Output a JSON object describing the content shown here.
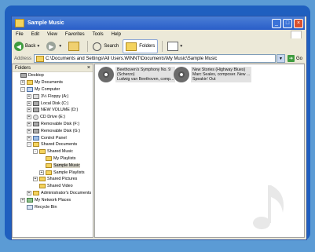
{
  "window": {
    "title": "Sample Music"
  },
  "menu": [
    "File",
    "Edit",
    "View",
    "Favorites",
    "Tools",
    "Help"
  ],
  "toolbar": {
    "back_label": "Back",
    "search_label": "Search",
    "folders_label": "Folders"
  },
  "address": {
    "label": "Address",
    "value": "C:\\Documents and Settings\\All Users.WINNT\\Documents\\My Music\\Sample Music",
    "go_label": "Go"
  },
  "folders_pane": {
    "title": "Folders",
    "items": [
      {
        "label": "Desktop",
        "indent": 0,
        "toggle": "",
        "icon": "dk"
      },
      {
        "label": "My Documents",
        "indent": 1,
        "toggle": "+",
        "icon": "f"
      },
      {
        "label": "My Computer",
        "indent": 1,
        "toggle": "-",
        "icon": "pc"
      },
      {
        "label": "3½ Floppy (A:)",
        "indent": 2,
        "toggle": "+",
        "icon": "fl"
      },
      {
        "label": "Local Disk (C:)",
        "indent": 2,
        "toggle": "+",
        "icon": "dk"
      },
      {
        "label": "NEW VOLUME (D:)",
        "indent": 2,
        "toggle": "+",
        "icon": "dk"
      },
      {
        "label": "CD Drive (E:)",
        "indent": 2,
        "toggle": "+",
        "icon": "cd"
      },
      {
        "label": "Removable Disk (F:)",
        "indent": 2,
        "toggle": "+",
        "icon": "dk"
      },
      {
        "label": "Removable Disk (G:)",
        "indent": 2,
        "toggle": "+",
        "icon": "dk"
      },
      {
        "label": "Control Panel",
        "indent": 2,
        "toggle": "+",
        "icon": "cp"
      },
      {
        "label": "Shared Documents",
        "indent": 2,
        "toggle": "-",
        "icon": "f"
      },
      {
        "label": "Shared Music",
        "indent": 3,
        "toggle": "-",
        "icon": "f"
      },
      {
        "label": "My Playlists",
        "indent": 4,
        "toggle": "",
        "icon": "f"
      },
      {
        "label": "Sample Music",
        "indent": 4,
        "toggle": "",
        "icon": "f",
        "selected": true
      },
      {
        "label": "Sample Playlists",
        "indent": 4,
        "toggle": "+",
        "icon": "f"
      },
      {
        "label": "Shared Pictures",
        "indent": 3,
        "toggle": "+",
        "icon": "f"
      },
      {
        "label": "Shared Video",
        "indent": 3,
        "toggle": "",
        "icon": "f"
      },
      {
        "label": "Administrator's Documents",
        "indent": 2,
        "toggle": "+",
        "icon": "f"
      },
      {
        "label": "My Network Places",
        "indent": 1,
        "toggle": "+",
        "icon": "net"
      },
      {
        "label": "Recycle Bin",
        "indent": 1,
        "toggle": "",
        "icon": "rb"
      }
    ]
  },
  "files": [
    {
      "line1": "Beethoven's Symphony No. 9",
      "line2": "(Scherzo)",
      "line3": "Ludwig van Beethoven, comp..."
    },
    {
      "line1": "New Stories (Highway Blues)",
      "line2": "Marc Seales, composer. New ...",
      "line3": "Speakin' Out"
    }
  ]
}
